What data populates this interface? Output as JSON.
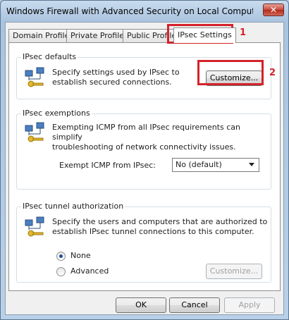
{
  "window": {
    "title": "Windows Firewall with Advanced Security on Local Computer Pro...",
    "close_glyph": "✕"
  },
  "tabs": [
    {
      "label": "Domain Profile"
    },
    {
      "label": "Private Profile"
    },
    {
      "label": "Public Profile"
    },
    {
      "label": "IPsec Settings"
    }
  ],
  "ipsec_defaults": {
    "title": "IPsec defaults",
    "line1": "Specify settings used by IPsec to",
    "line2": "establish secured connections.",
    "button": "Customize..."
  },
  "ipsec_exemptions": {
    "title": "IPsec exemptions",
    "line1": "Exempting ICMP from all IPsec requirements can simplify",
    "line2": "troubleshooting of network connectivity issues.",
    "field_label": "Exempt ICMP from IPsec:",
    "field_value": "No (default)"
  },
  "tunnel_auth": {
    "title": "IPsec tunnel authorization",
    "line1": "Specify the users and computers that are authorized to",
    "line2": "establish IPsec tunnel connections to this computer.",
    "option_none": "None",
    "option_advanced": "Advanced",
    "button": "Customize..."
  },
  "footer": {
    "ok": "OK",
    "cancel": "Cancel",
    "apply": "Apply"
  },
  "annotations": {
    "step1": "1",
    "step2": "2",
    "color": "#d4222a"
  },
  "icons": {
    "group_icon": "network-key-icon"
  }
}
